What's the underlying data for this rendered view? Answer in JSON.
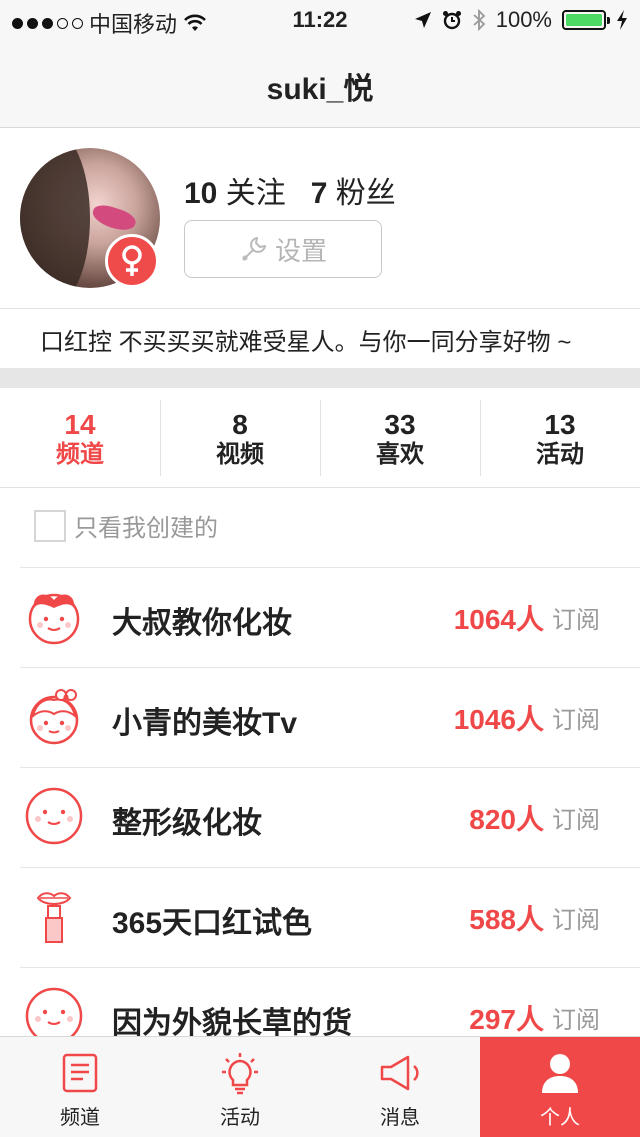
{
  "status_bar": {
    "carrier": "中国移动",
    "time": "11:22",
    "battery": "100%"
  },
  "nav": {
    "title": "suki_悦"
  },
  "profile": {
    "following_count": "10",
    "following_label": "关注",
    "followers_count": "7",
    "followers_label": "粉丝",
    "settings_label": "设置",
    "bio": "口红控 不买买买就难受星人。与你一同分享好物 ~"
  },
  "stats": [
    {
      "count": "14",
      "label": "频道"
    },
    {
      "count": "8",
      "label": "视频"
    },
    {
      "count": "33",
      "label": "喜欢"
    },
    {
      "count": "13",
      "label": "活动"
    }
  ],
  "filter": {
    "label": "只看我创建的"
  },
  "channels": [
    {
      "name": "大叔教你化妆",
      "count": "1064人",
      "action": "订阅",
      "icon": "face-with-bow-icon"
    },
    {
      "name": "小青的美妆Tv",
      "count": "1046人",
      "action": "订阅",
      "icon": "face-with-hair-bow-icon"
    },
    {
      "name": "整形级化妆",
      "count": "820人",
      "action": "订阅",
      "icon": "smiley-face-icon"
    },
    {
      "name": "365天口红试色",
      "count": "588人",
      "action": "订阅",
      "icon": "lipstick-icon"
    },
    {
      "name": "因为外貌长草的货",
      "count": "297人",
      "action": "订阅",
      "icon": "smiley-face-icon"
    }
  ],
  "tab_bar": [
    {
      "label": "频道",
      "icon": "document-icon"
    },
    {
      "label": "活动",
      "icon": "lightbulb-icon"
    },
    {
      "label": "消息",
      "icon": "megaphone-icon"
    },
    {
      "label": "个人",
      "icon": "person-icon"
    }
  ],
  "colors": {
    "accent": "#f04848",
    "battery": "#4cd964"
  }
}
